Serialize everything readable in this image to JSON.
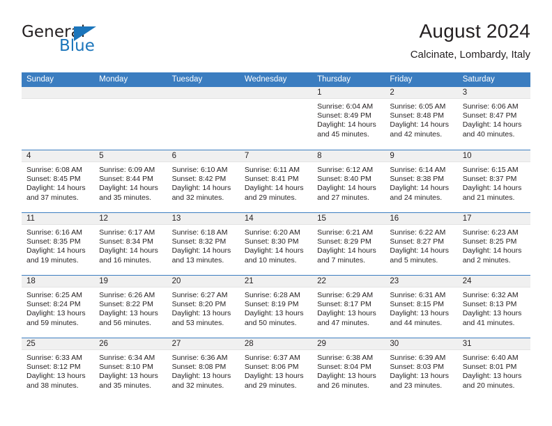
{
  "brand": {
    "name_part1": "General",
    "name_part2": "Blue",
    "triangle_color": "#1b75bb"
  },
  "header": {
    "title": "August 2024",
    "subtitle": "Calcinate, Lombardy, Italy"
  },
  "colors": {
    "header_blue": "#3b7dc0",
    "daynum_band": "#f0f0f0",
    "text": "#231f20"
  },
  "weekdays": [
    "Sunday",
    "Monday",
    "Tuesday",
    "Wednesday",
    "Thursday",
    "Friday",
    "Saturday"
  ],
  "weeks": [
    [
      {
        "day": "",
        "sunrise": "",
        "sunset": "",
        "daylight": ""
      },
      {
        "day": "",
        "sunrise": "",
        "sunset": "",
        "daylight": ""
      },
      {
        "day": "",
        "sunrise": "",
        "sunset": "",
        "daylight": ""
      },
      {
        "day": "",
        "sunrise": "",
        "sunset": "",
        "daylight": ""
      },
      {
        "day": "1",
        "sunrise": "Sunrise: 6:04 AM",
        "sunset": "Sunset: 8:49 PM",
        "daylight": "Daylight: 14 hours and 45 minutes."
      },
      {
        "day": "2",
        "sunrise": "Sunrise: 6:05 AM",
        "sunset": "Sunset: 8:48 PM",
        "daylight": "Daylight: 14 hours and 42 minutes."
      },
      {
        "day": "3",
        "sunrise": "Sunrise: 6:06 AM",
        "sunset": "Sunset: 8:47 PM",
        "daylight": "Daylight: 14 hours and 40 minutes."
      }
    ],
    [
      {
        "day": "4",
        "sunrise": "Sunrise: 6:08 AM",
        "sunset": "Sunset: 8:45 PM",
        "daylight": "Daylight: 14 hours and 37 minutes."
      },
      {
        "day": "5",
        "sunrise": "Sunrise: 6:09 AM",
        "sunset": "Sunset: 8:44 PM",
        "daylight": "Daylight: 14 hours and 35 minutes."
      },
      {
        "day": "6",
        "sunrise": "Sunrise: 6:10 AM",
        "sunset": "Sunset: 8:42 PM",
        "daylight": "Daylight: 14 hours and 32 minutes."
      },
      {
        "day": "7",
        "sunrise": "Sunrise: 6:11 AM",
        "sunset": "Sunset: 8:41 PM",
        "daylight": "Daylight: 14 hours and 29 minutes."
      },
      {
        "day": "8",
        "sunrise": "Sunrise: 6:12 AM",
        "sunset": "Sunset: 8:40 PM",
        "daylight": "Daylight: 14 hours and 27 minutes."
      },
      {
        "day": "9",
        "sunrise": "Sunrise: 6:14 AM",
        "sunset": "Sunset: 8:38 PM",
        "daylight": "Daylight: 14 hours and 24 minutes."
      },
      {
        "day": "10",
        "sunrise": "Sunrise: 6:15 AM",
        "sunset": "Sunset: 8:37 PM",
        "daylight": "Daylight: 14 hours and 21 minutes."
      }
    ],
    [
      {
        "day": "11",
        "sunrise": "Sunrise: 6:16 AM",
        "sunset": "Sunset: 8:35 PM",
        "daylight": "Daylight: 14 hours and 19 minutes."
      },
      {
        "day": "12",
        "sunrise": "Sunrise: 6:17 AM",
        "sunset": "Sunset: 8:34 PM",
        "daylight": "Daylight: 14 hours and 16 minutes."
      },
      {
        "day": "13",
        "sunrise": "Sunrise: 6:18 AM",
        "sunset": "Sunset: 8:32 PM",
        "daylight": "Daylight: 14 hours and 13 minutes."
      },
      {
        "day": "14",
        "sunrise": "Sunrise: 6:20 AM",
        "sunset": "Sunset: 8:30 PM",
        "daylight": "Daylight: 14 hours and 10 minutes."
      },
      {
        "day": "15",
        "sunrise": "Sunrise: 6:21 AM",
        "sunset": "Sunset: 8:29 PM",
        "daylight": "Daylight: 14 hours and 7 minutes."
      },
      {
        "day": "16",
        "sunrise": "Sunrise: 6:22 AM",
        "sunset": "Sunset: 8:27 PM",
        "daylight": "Daylight: 14 hours and 5 minutes."
      },
      {
        "day": "17",
        "sunrise": "Sunrise: 6:23 AM",
        "sunset": "Sunset: 8:25 PM",
        "daylight": "Daylight: 14 hours and 2 minutes."
      }
    ],
    [
      {
        "day": "18",
        "sunrise": "Sunrise: 6:25 AM",
        "sunset": "Sunset: 8:24 PM",
        "daylight": "Daylight: 13 hours and 59 minutes."
      },
      {
        "day": "19",
        "sunrise": "Sunrise: 6:26 AM",
        "sunset": "Sunset: 8:22 PM",
        "daylight": "Daylight: 13 hours and 56 minutes."
      },
      {
        "day": "20",
        "sunrise": "Sunrise: 6:27 AM",
        "sunset": "Sunset: 8:20 PM",
        "daylight": "Daylight: 13 hours and 53 minutes."
      },
      {
        "day": "21",
        "sunrise": "Sunrise: 6:28 AM",
        "sunset": "Sunset: 8:19 PM",
        "daylight": "Daylight: 13 hours and 50 minutes."
      },
      {
        "day": "22",
        "sunrise": "Sunrise: 6:29 AM",
        "sunset": "Sunset: 8:17 PM",
        "daylight": "Daylight: 13 hours and 47 minutes."
      },
      {
        "day": "23",
        "sunrise": "Sunrise: 6:31 AM",
        "sunset": "Sunset: 8:15 PM",
        "daylight": "Daylight: 13 hours and 44 minutes."
      },
      {
        "day": "24",
        "sunrise": "Sunrise: 6:32 AM",
        "sunset": "Sunset: 8:13 PM",
        "daylight": "Daylight: 13 hours and 41 minutes."
      }
    ],
    [
      {
        "day": "25",
        "sunrise": "Sunrise: 6:33 AM",
        "sunset": "Sunset: 8:12 PM",
        "daylight": "Daylight: 13 hours and 38 minutes."
      },
      {
        "day": "26",
        "sunrise": "Sunrise: 6:34 AM",
        "sunset": "Sunset: 8:10 PM",
        "daylight": "Daylight: 13 hours and 35 minutes."
      },
      {
        "day": "27",
        "sunrise": "Sunrise: 6:36 AM",
        "sunset": "Sunset: 8:08 PM",
        "daylight": "Daylight: 13 hours and 32 minutes."
      },
      {
        "day": "28",
        "sunrise": "Sunrise: 6:37 AM",
        "sunset": "Sunset: 8:06 PM",
        "daylight": "Daylight: 13 hours and 29 minutes."
      },
      {
        "day": "29",
        "sunrise": "Sunrise: 6:38 AM",
        "sunset": "Sunset: 8:04 PM",
        "daylight": "Daylight: 13 hours and 26 minutes."
      },
      {
        "day": "30",
        "sunrise": "Sunrise: 6:39 AM",
        "sunset": "Sunset: 8:03 PM",
        "daylight": "Daylight: 13 hours and 23 minutes."
      },
      {
        "day": "31",
        "sunrise": "Sunrise: 6:40 AM",
        "sunset": "Sunset: 8:01 PM",
        "daylight": "Daylight: 13 hours and 20 minutes."
      }
    ]
  ]
}
